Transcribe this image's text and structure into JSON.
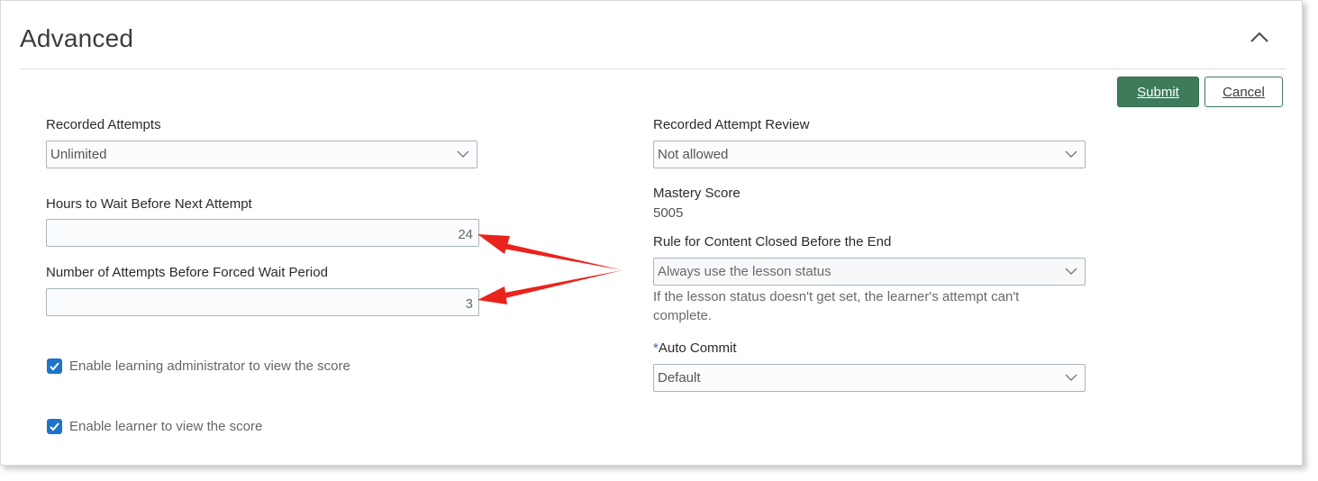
{
  "section": {
    "title": "Advanced"
  },
  "actions": {
    "submit_label": "Submit",
    "cancel_label": "Cancel"
  },
  "left": {
    "recorded_attempts": {
      "label": "Recorded Attempts",
      "value": "Unlimited"
    },
    "hours_to_wait": {
      "label": "Hours to Wait Before Next Attempt",
      "value": "24"
    },
    "attempts_before_wait": {
      "label": "Number of Attempts Before Forced Wait Period",
      "value": "3"
    },
    "checkboxes": [
      {
        "label": "Enable learning administrator to view the score",
        "checked": true
      },
      {
        "label": "Enable learner to view the score",
        "checked": true
      }
    ]
  },
  "right": {
    "attempt_review": {
      "label": "Recorded Attempt Review",
      "value": "Not allowed"
    },
    "mastery_score": {
      "label": "Mastery Score",
      "value": "5005"
    },
    "rule_closed": {
      "label": "Rule for Content Closed Before the End",
      "value": "Always use the lesson status",
      "help": "If the lesson status doesn't get set, the learner's attempt can't complete."
    },
    "auto_commit": {
      "required_marker": "*",
      "label": "Auto Commit",
      "value": "Default"
    }
  },
  "colors": {
    "primary_button": "#3e7b5b",
    "checkbox": "#1f73c9",
    "annotation_arrow": "#e8241c"
  },
  "icons": {
    "collapse": "chevron-up-icon",
    "dropdown": "chevron-down-icon",
    "checkbox": "checkmark-icon"
  }
}
